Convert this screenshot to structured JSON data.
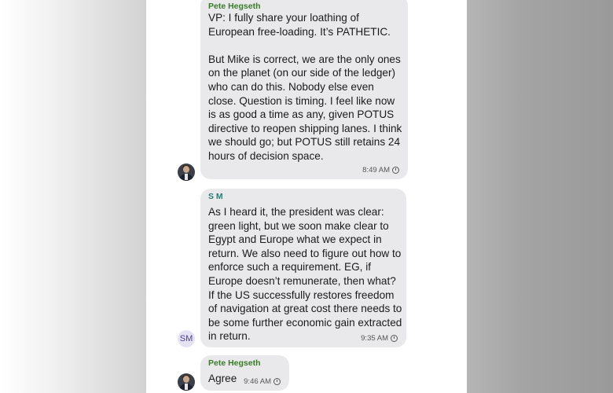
{
  "messages": [
    {
      "sender": "Pete Hegseth",
      "text": "VP: I fully share your loathing of European free-loading. It’s PATHETIC.\n\nBut Mike is correct, we are the only ones on the planet (on our side of the ledger) who can do this. Nobody else even close. Question is timing. I feel like now is as good a time as any, given POTUS directive to reopen shipping lanes. I think we should go; but POTUS still retains 24 hours of decision space.",
      "time": "8:49 AM",
      "avatar": "profile-photo",
      "sender_color": "#3b7a2a"
    },
    {
      "sender": "S M",
      "text": "As I heard it, the president was clear: green light, but we soon make clear to Egypt and Europe what we expect in return. We also need to figure out how to enforce such a requirement. EG, if Europe doesn’t remunerate, then what? If the US successfully restores freedom of navigation at great cost there needs to be some further economic gain extracted in return.",
      "time": "9:35 AM",
      "avatar_initials": "SM",
      "sender_color": "#2e7a72"
    },
    {
      "sender": "Pete Hegseth",
      "text": "Agree",
      "time": "9:46 AM",
      "avatar": "profile-photo",
      "sender_color": "#3b7a2a"
    }
  ],
  "icons": {
    "timestamp": "clock-icon"
  }
}
